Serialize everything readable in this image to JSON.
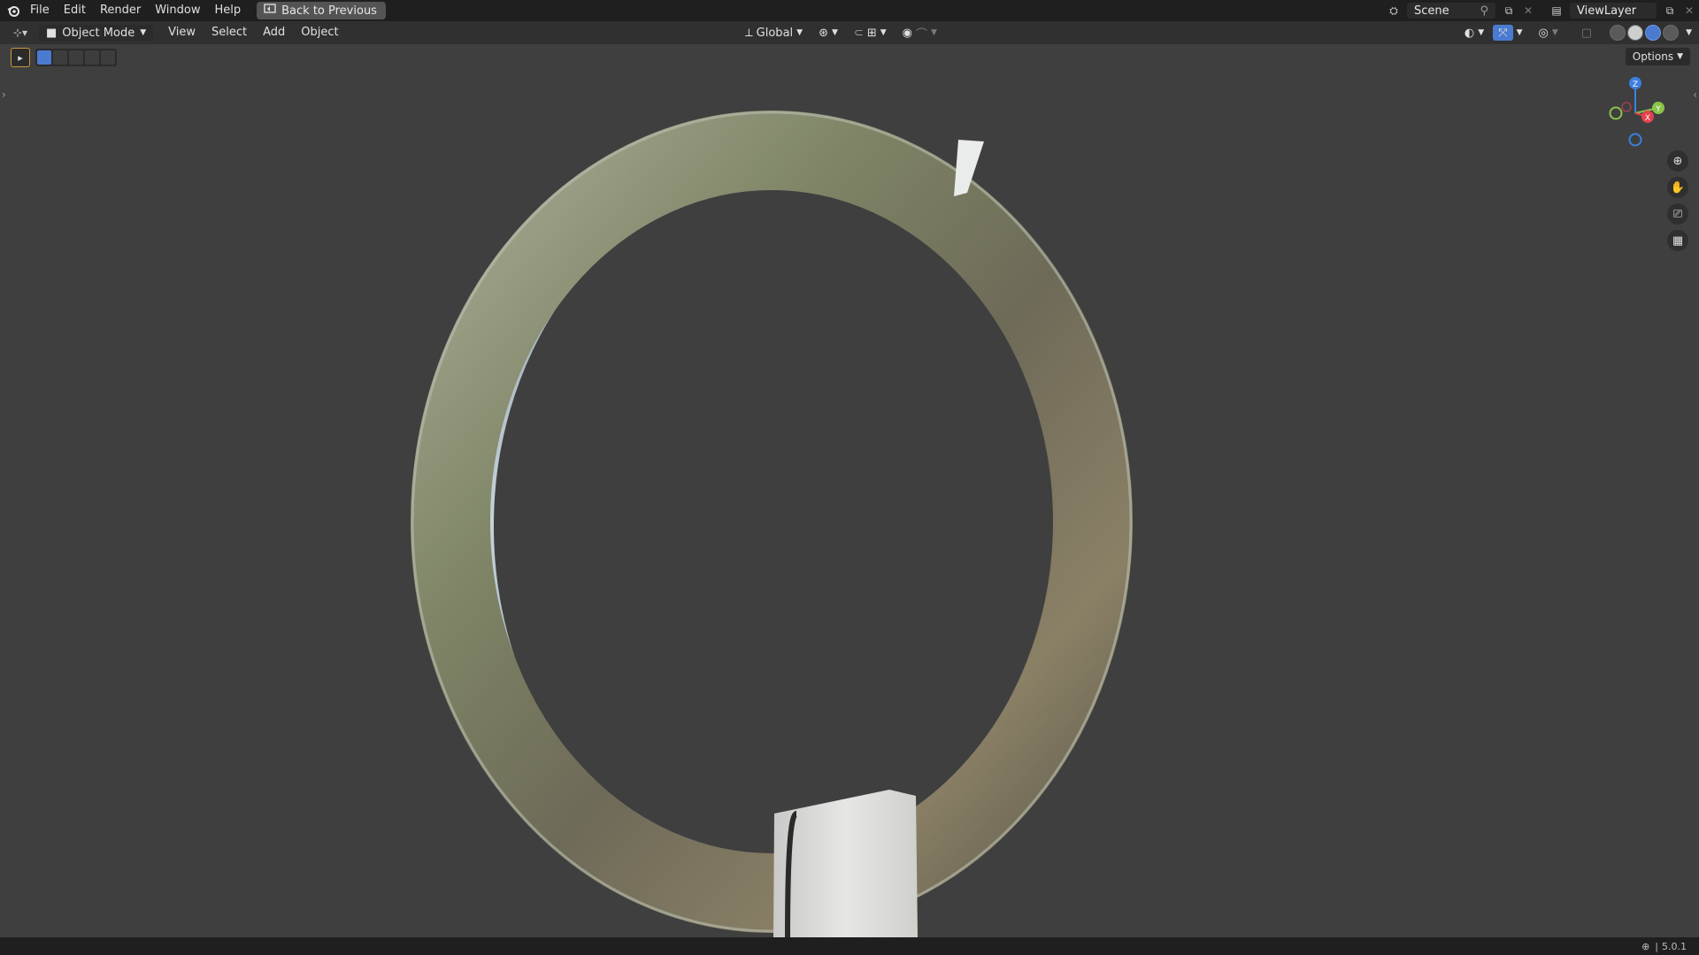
{
  "topbar": {
    "menu": [
      "File",
      "Edit",
      "Render",
      "Window",
      "Help"
    ],
    "back_label": "Back to Previous",
    "scene": "Scene",
    "view_layer": "ViewLayer"
  },
  "header": {
    "mode": "Object Mode",
    "menu": [
      "View",
      "Select",
      "Add",
      "Object"
    ],
    "orientation": "Global"
  },
  "viewport": {
    "options_label": "Options",
    "gizmo_axes": [
      "Z",
      "Y",
      "X"
    ]
  },
  "status": {
    "version": "5.0.1"
  },
  "colors": {
    "background": "#3f3f3f",
    "accent": "#4a7bd1",
    "axis_x": "#e2414f",
    "axis_y": "#8bc34a",
    "axis_z": "#3d7fe0"
  },
  "icons": [
    "blender-logo-icon",
    "editor-type-icon",
    "cursor-icon",
    "transform-orientation-icon",
    "pivot-icon",
    "snap-icon",
    "proportional-edit-icon",
    "visibility-icon",
    "gizmo-icon",
    "overlay-icon",
    "xray-icon",
    "zoom-icon",
    "hand-icon",
    "camera-icon",
    "grid-icon",
    "globe-icon"
  ]
}
